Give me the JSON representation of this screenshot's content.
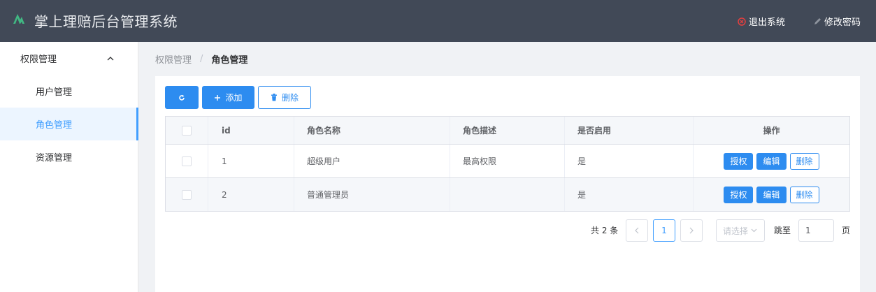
{
  "header": {
    "title": "掌上理赔后台管理系统",
    "logout_label": "退出系统",
    "change_password_label": "修改密码"
  },
  "sidebar": {
    "group_label": "权限管理",
    "items": [
      {
        "label": "用户管理",
        "active": false
      },
      {
        "label": "角色管理",
        "active": true
      },
      {
        "label": "资源管理",
        "active": false
      }
    ]
  },
  "breadcrumb": [
    "权限管理",
    "/",
    "角色管理"
  ],
  "toolbar": {
    "add_label": "添加",
    "delete_label": "删除"
  },
  "table": {
    "columns": [
      "id",
      "角色名称",
      "角色描述",
      "是否启用",
      "操作"
    ],
    "rows": [
      {
        "id": "1",
        "name": "超级用户",
        "desc": "最高权限",
        "enabled": "是"
      },
      {
        "id": "2",
        "name": "普通管理员",
        "desc": "",
        "enabled": "是"
      }
    ],
    "actions": {
      "authorize": "授权",
      "edit": "编辑",
      "delete": "删除"
    }
  },
  "pagination": {
    "total_text": "共 2 条",
    "current_page": "1",
    "page_size_placeholder": "请选择",
    "jump_label": "跳至",
    "jump_value": "1",
    "page_unit": "页"
  },
  "colors": {
    "header_bg": "#414957",
    "primary": "#2d8cf0",
    "active_menu_bg": "#ecf5ff"
  }
}
